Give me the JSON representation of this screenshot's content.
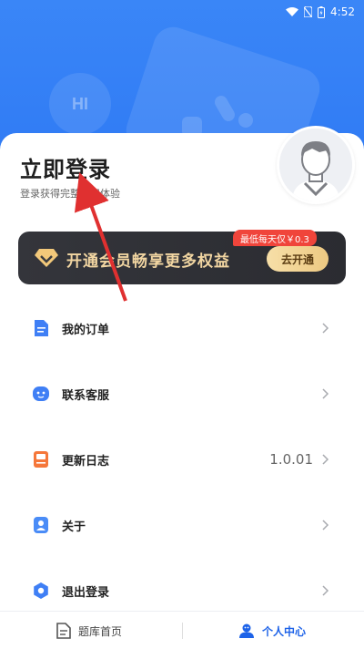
{
  "status_bar": {
    "time": "4:52"
  },
  "header": {
    "deco_badge": "HI"
  },
  "login": {
    "title": "立即登录",
    "subtitle": "登录获得完整使用体验"
  },
  "vip": {
    "text": "开通会员畅享更多权益",
    "button": "去开通",
    "tag": "最低每天仅￥0.3"
  },
  "menu": {
    "items": [
      {
        "label": "我的订单",
        "value": "",
        "icon": "document-icon"
      },
      {
        "label": "联系客服",
        "value": "",
        "icon": "service-face-icon"
      },
      {
        "label": "更新日志",
        "value": "1.0.01",
        "icon": "log-icon"
      },
      {
        "label": "关于",
        "value": "",
        "icon": "user-card-icon"
      },
      {
        "label": "退出登录",
        "value": "",
        "icon": "logout-gear-icon"
      }
    ]
  },
  "tabs": {
    "home": "题库首页",
    "me": "个人中心"
  },
  "colors": {
    "primary": "#2f7af4",
    "vip_gold": "#f2d6a2",
    "tag_red": "#f0453b",
    "annotation_red": "#e03030"
  }
}
